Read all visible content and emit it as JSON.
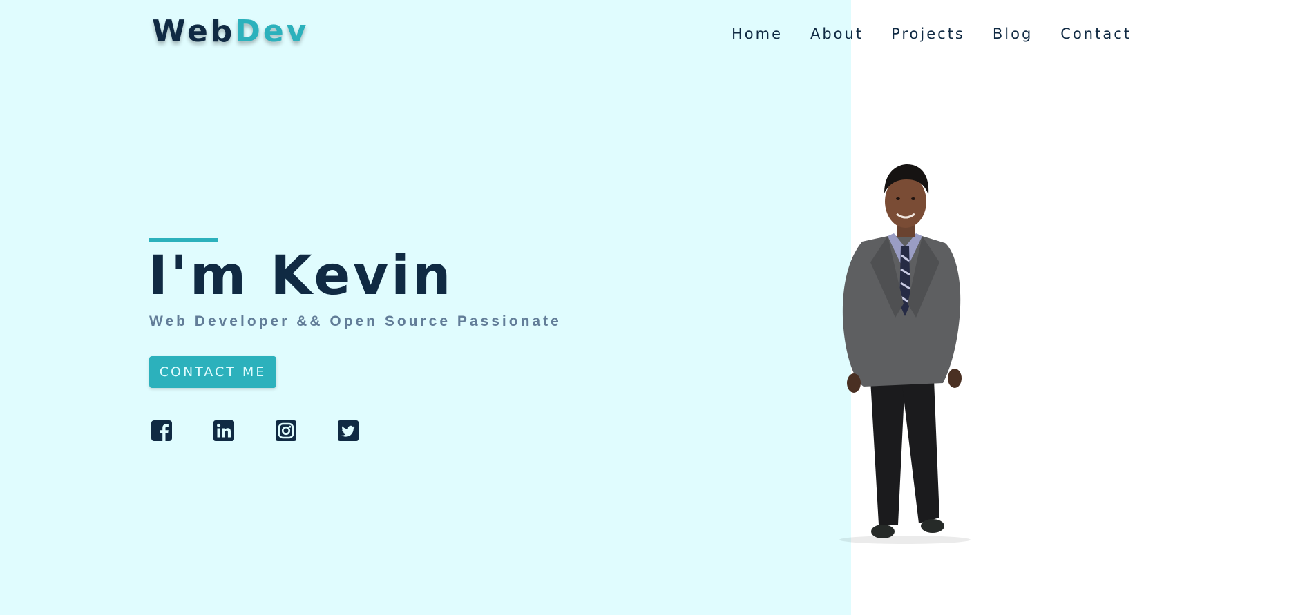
{
  "header": {
    "logo_part1": "Web",
    "logo_part2": "Dev",
    "nav": [
      {
        "label": "Home"
      },
      {
        "label": "About"
      },
      {
        "label": "Projects"
      },
      {
        "label": "Blog"
      },
      {
        "label": "Contact"
      }
    ]
  },
  "hero": {
    "title": "I'm Kevin",
    "subtitle": "Web Developer && Open Source Passionate",
    "cta_label": "CONTACT ME",
    "socials": [
      {
        "icon": "facebook-icon"
      },
      {
        "icon": "linkedin-icon"
      },
      {
        "icon": "instagram-icon"
      },
      {
        "icon": "twitter-icon"
      }
    ]
  },
  "colors": {
    "primary": "#102a43",
    "accent": "#2cb1bc",
    "muted": "#627d98",
    "hero_bg": "#e0fcfe",
    "right_bg": "#ffffff"
  }
}
